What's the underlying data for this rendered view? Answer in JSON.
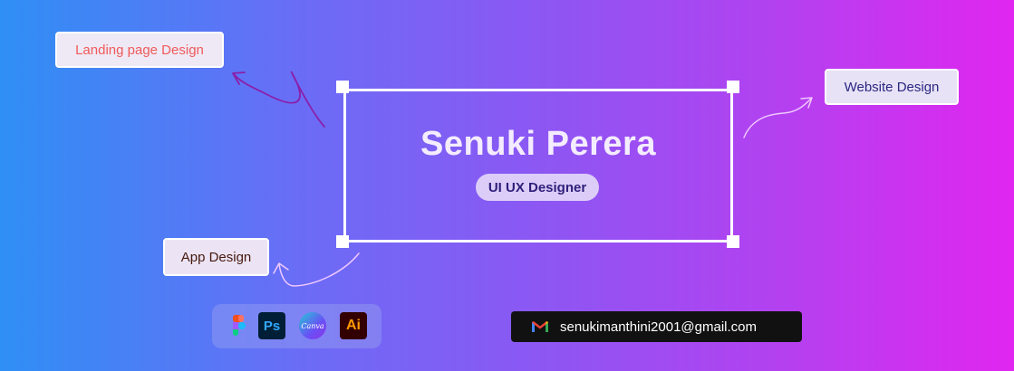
{
  "tags": {
    "landing": "Landing page Design",
    "website": "Website Design",
    "app": "App Design"
  },
  "name": "Senuki Perera",
  "role": "UI UX Designer",
  "tools": {
    "icons": [
      "figma-icon",
      "photoshop-icon",
      "canva-icon",
      "illustrator-icon"
    ],
    "photoshop_label": "Ps",
    "canva_label": "Canva",
    "illustrator_label": "Ai"
  },
  "contact": {
    "icon": "gmail-icon",
    "email": "senukimanthini2001@gmail.com"
  },
  "colors": {
    "landing_text": "#ef5a5a",
    "website_text": "#2a2780",
    "app_text": "#45180d",
    "frame": "#ffffff",
    "role_badge_bg": "#dccdf8"
  }
}
